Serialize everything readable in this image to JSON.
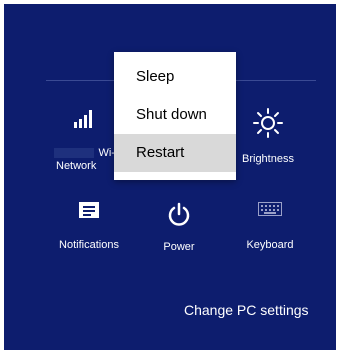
{
  "menu": {
    "items": [
      {
        "label": "Sleep"
      },
      {
        "label": "Shut down"
      },
      {
        "label": "Restart",
        "selected": true
      }
    ]
  },
  "tiles": {
    "wifi": {
      "label_top": "Wi-I",
      "label_bottom": "Network",
      "icon": "signal-bars-icon"
    },
    "brightness": {
      "label": "Brightness",
      "icon": "sun-icon"
    },
    "notifications": {
      "label": "Notifications",
      "icon": "notifications-icon"
    },
    "power": {
      "label": "Power",
      "icon": "power-icon"
    },
    "keyboard": {
      "label": "Keyboard",
      "icon": "keyboard-icon"
    }
  },
  "footer": {
    "settings_link": "Change PC settings"
  },
  "colors": {
    "background": "#0d1d6e",
    "menu_bg": "#ffffff",
    "selected_bg": "#d9d9d9",
    "text": "#ffffff"
  }
}
